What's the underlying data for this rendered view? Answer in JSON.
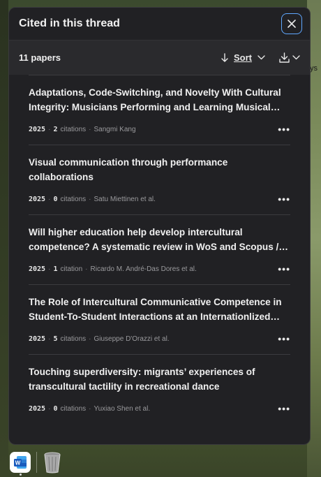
{
  "panel": {
    "title": "Cited in this thread",
    "close_icon": "close-icon"
  },
  "toolbar": {
    "count_label": "11 papers",
    "sort_label": "Sort",
    "sort_icon": "arrow-down-icon",
    "download_icon": "download-icon"
  },
  "papers": [
    {
      "title_line1": "Adaptations, Code-Switching, and Novelty With Cultural",
      "title_line2": "Integrity: Musicians Performing and Learning Musical…",
      "year": "2025",
      "count": "2",
      "count_label": "citations",
      "authors": "Sangmi Kang"
    },
    {
      "title_line1": "Visual communication through performance collaborations",
      "title_line2": "",
      "year": "2025",
      "count": "0",
      "count_label": "citations",
      "authors": "Satu Miettinen et al."
    },
    {
      "title_line1": "Will higher education help develop intercultural",
      "title_line2": "competence? A systematic review in WoS and Scopus /…",
      "year": "2025",
      "count": "1",
      "count_label": "citation",
      "authors": "Ricardo M. André-Das Dores et al."
    },
    {
      "title_line1": "The Role of Intercultural Communicative Competence in",
      "title_line2": "Student-To-Student Interactions at an Internationlized…",
      "year": "2025",
      "count": "5",
      "count_label": "citations",
      "authors": "Giuseppe D'Orazzi et al."
    },
    {
      "title_line1": "Touching superdiversity: migrants’ experiences of",
      "title_line2": "transcultural tactility in recreational dance",
      "year": "2025",
      "count": "0",
      "count_label": "citations",
      "authors": "Yuxiao Shen et al."
    }
  ],
  "more_label": "•••",
  "separator": "·",
  "background": {
    "partial_text": "ys"
  },
  "dock": {
    "word_letter": "W",
    "items": [
      "word-app-icon",
      "trash-icon"
    ]
  },
  "colors": {
    "panel_bg": "#212124",
    "accent": "#5fa8ff"
  }
}
